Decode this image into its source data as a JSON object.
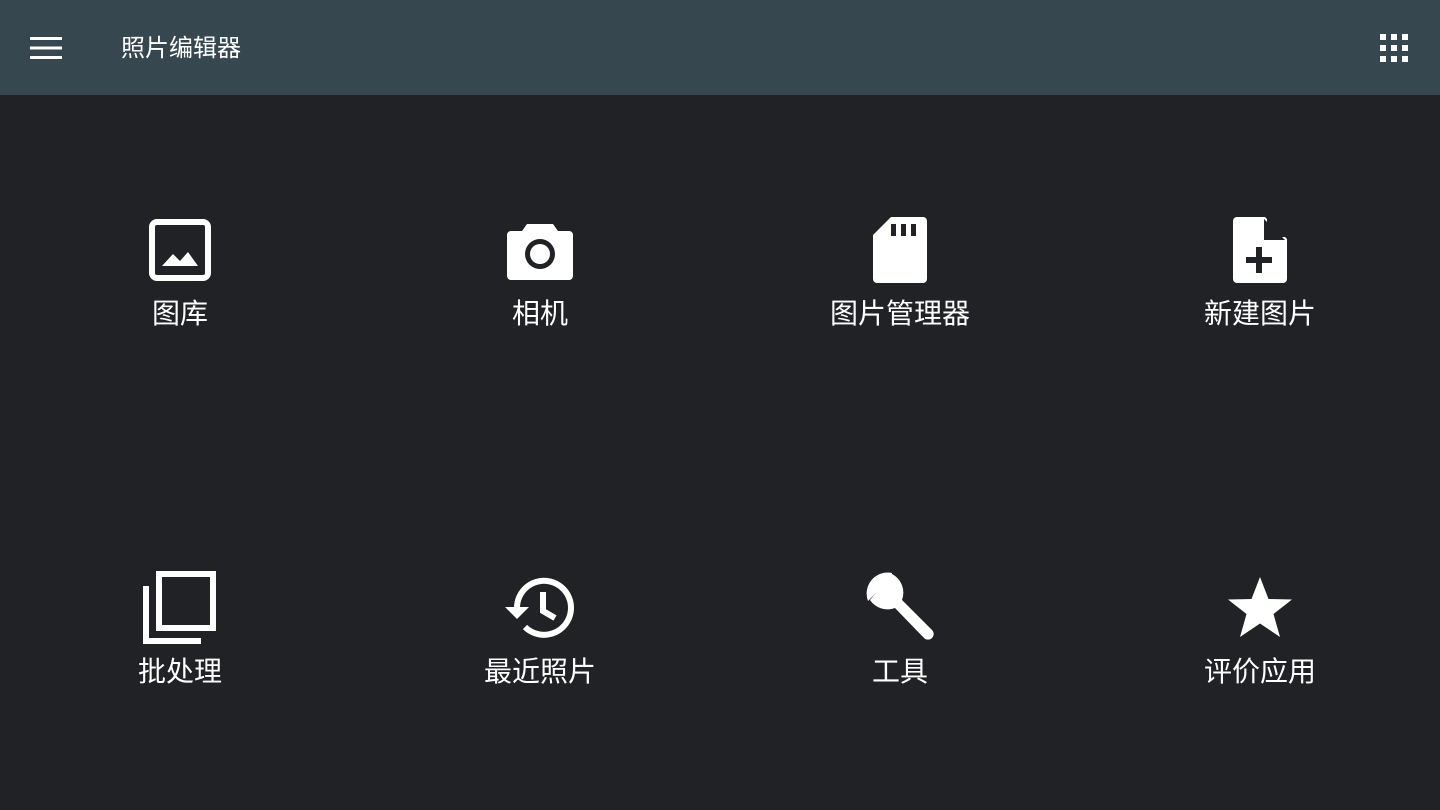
{
  "appbar": {
    "title": "照片编辑器",
    "menu_icon": "menu-icon",
    "apps_icon": "apps-grid-icon",
    "background": "#37474f"
  },
  "background": "#212226",
  "tiles": [
    {
      "label": "图库",
      "icon": "image-icon"
    },
    {
      "label": "相机",
      "icon": "camera-icon"
    },
    {
      "label": "图片管理器",
      "icon": "sd-card-icon"
    },
    {
      "label": "新建图片",
      "icon": "note-add-icon"
    },
    {
      "label": "批处理",
      "icon": "filter-none-icon"
    },
    {
      "label": "最近照片",
      "icon": "history-icon"
    },
    {
      "label": "工具",
      "icon": "wrench-icon"
    },
    {
      "label": "评价应用",
      "icon": "star-icon"
    }
  ]
}
